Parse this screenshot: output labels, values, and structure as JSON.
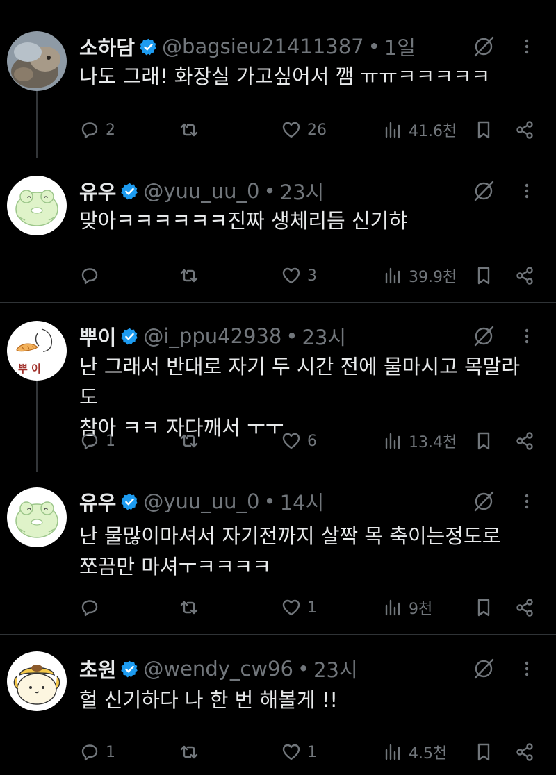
{
  "tweets": [
    {
      "name": "소하담",
      "handle": "@bagsieu21411387",
      "dot": "•",
      "time": "1일",
      "lines": [
        "나도 그래! 화장실 가고싶어서 깸 ㅠㅠㅋㅋㅋㅋㅋ"
      ],
      "replies": "2",
      "retweets": "",
      "likes": "26",
      "views": "41.6천",
      "avatar": "rabbit-photo"
    },
    {
      "name": "유우",
      "handle": "@yuu_uu_0",
      "dot": "•",
      "time": "23시",
      "lines": [
        "맞아ㅋㅋㅋㅋㅋㅋ진짜 생체리듬 신기햐"
      ],
      "replies": "",
      "retweets": "",
      "likes": "3",
      "views": "39.9천",
      "avatar": "green-frog-drawing"
    },
    {
      "name": "뿌이",
      "handle": "@i_ppu42938",
      "dot": "•",
      "time": "23시",
      "lines": [
        "난 그래서 반대로 자기 두 시간 전에 물마시고 목말라도",
        "참아 ㅋㅋ 자다깨서 ㅜㅜ"
      ],
      "replies": "1",
      "retweets": "",
      "likes": "6",
      "views": "13.4천",
      "avatar": "croissant-girl-drawing",
      "avatar_text": "뿌 이"
    },
    {
      "name": "유우",
      "handle": "@yuu_uu_0",
      "dot": "•",
      "time": "14시",
      "lines": [
        "난 물많이마셔서 자기전까지 살짝 목 축이는정도로",
        "쪼끔만 마셔ㅜㅋㅋㅋㅋ"
      ],
      "replies": "",
      "retweets": "",
      "likes": "1",
      "views": "9천",
      "avatar": "green-frog-drawing"
    },
    {
      "name": "초원",
      "handle": "@wendy_cw96",
      "dot": "•",
      "time": "23시",
      "lines": [
        "헐 신기하다 나 한 번 해볼게 !!"
      ],
      "replies": "1",
      "retweets": "",
      "likes": "1",
      "views": "4.5천",
      "avatar": "pompompurin-drawing"
    }
  ],
  "colors": {
    "background": "#000000",
    "text": "#e7e9ea",
    "muted": "#71767b",
    "verified": "#1d9bf0",
    "divider": "#2f3336"
  }
}
